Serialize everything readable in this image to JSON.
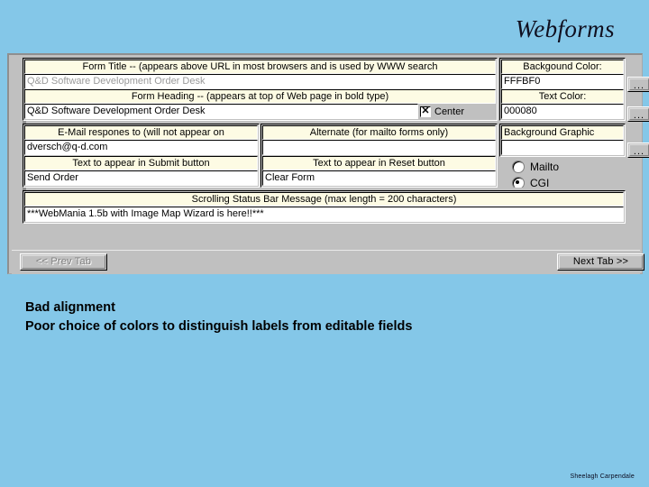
{
  "slide": {
    "title": "Webforms",
    "background_color": "#84c7e8",
    "credit": "Sheelagh Carpendale"
  },
  "commentary": {
    "lines": [
      "Bad alignment",
      "Poor choice of colors to distinguish labels from editable fields"
    ]
  },
  "app": {
    "colors": {
      "face": "#c0c0c0",
      "label_band": "#fdfbe4",
      "field": "#ffffff",
      "text": "#000000",
      "ghost_text": "#9a9a9a"
    },
    "fields": {
      "form_title": {
        "label": "Form Title -- (appears above URL in most browsers and is used by WWW search",
        "value": "Q&D Software Development Order Desk",
        "ghost": true
      },
      "form_heading": {
        "label": "Form Heading -- (appears at top of Web page in bold type)",
        "value": "Q&D Software Development Order Desk",
        "ghost": false
      },
      "center_checkbox": {
        "label": "Center",
        "checked": true
      },
      "email_to": {
        "label": "E-Mail respones to (will not appear on",
        "value": "dversch@q-d.com"
      },
      "alternate": {
        "label": "Alternate (for mailto forms only)",
        "value": ""
      },
      "submit_text": {
        "label": "Text to appear in Submit button",
        "value": "Send Order"
      },
      "reset_text": {
        "label": "Text to appear in Reset button",
        "value": "Clear Form"
      },
      "status_bar": {
        "label": "Scrolling Status Bar Message (max length = 200 characters)",
        "value": "***WebMania 1.5b with Image Map Wizard is here!!***"
      },
      "background_color": {
        "label": "Backgound Color:",
        "value": "FFFBF0"
      },
      "text_color": {
        "label": "Text Color:",
        "value": "000080"
      },
      "background_graphic": {
        "label": "Background Graphic",
        "value": ""
      }
    },
    "protocol": {
      "options": [
        {
          "label": "Mailto",
          "selected": false
        },
        {
          "label": "CGI",
          "selected": true
        }
      ]
    },
    "browse_buttons": {
      "label": "...",
      "count": 3
    },
    "nav": {
      "prev_label": "<< Prev Tab",
      "prev_disabled": true,
      "next_label": "Next Tab >>",
      "next_disabled": false
    }
  }
}
